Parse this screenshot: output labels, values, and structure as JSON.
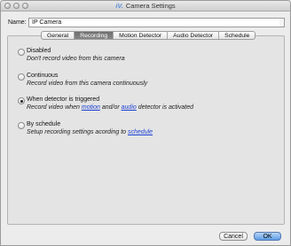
{
  "window": {
    "title": "Camera Settings",
    "app_icon_glyph": "iV."
  },
  "name_field": {
    "label": "Name:",
    "value": "IP Camera"
  },
  "tabs": [
    {
      "label": "General",
      "active": false
    },
    {
      "label": "Recording",
      "active": true
    },
    {
      "label": "Motion Detector",
      "active": false
    },
    {
      "label": "Audio Detector",
      "active": false
    },
    {
      "label": "Schedule",
      "active": false
    }
  ],
  "recording_options": {
    "disabled": {
      "title": "Disabled",
      "description": "Don't record video from this camera",
      "checked": false
    },
    "continuous": {
      "title": "Continuous",
      "description": "Record video from this camera continuously",
      "checked": false
    },
    "detector": {
      "title": "When detector is triggered",
      "desc_prefix": "Record video when ",
      "link_motion": "motion",
      "desc_middle": " and/or ",
      "link_audio": "audio",
      "desc_suffix": " detector is activated",
      "checked": true
    },
    "schedule": {
      "title": "By schedule",
      "desc_prefix": "Setup recording settings acording to ",
      "link_schedule": "schedule",
      "checked": false
    }
  },
  "buttons": {
    "cancel": "Cancel",
    "ok": "OK"
  },
  "colors": {
    "link": "#1a3fd6",
    "active_tab": "#7a7a7a",
    "primary_button": "#5e9ce8"
  }
}
